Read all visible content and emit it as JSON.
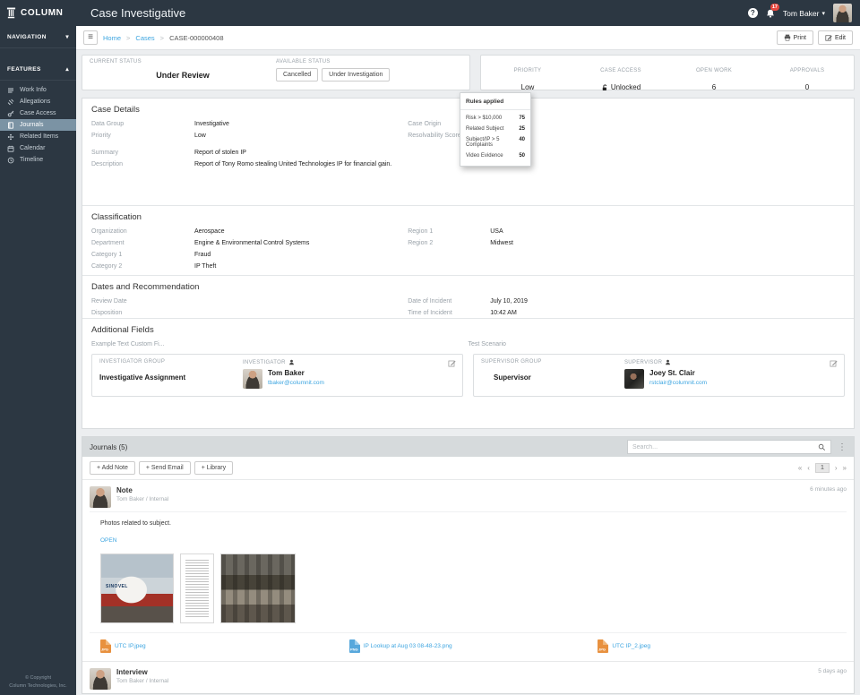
{
  "colors": {
    "topbar": "#2c3742",
    "accent_link": "#3da5e0",
    "selected_nav": "#7b93a4",
    "badge": "#e8483f"
  },
  "glyphs": {
    "plus": "+",
    "caret_down": "▾",
    "caret_up": "▴",
    "kebab": "⋮",
    "crumb_sep": ">",
    "pag_first": "«",
    "pag_prev": "‹",
    "pag_next": "›",
    "pag_last": "»",
    "help": "?",
    "info": "i",
    "hamburger": "≡"
  },
  "topbar": {
    "brand": "COLUMN",
    "title": "Case Investigative",
    "notification_count": "17",
    "user_name": "Tom Baker"
  },
  "sidebar": {
    "navigation_label": "NAVIGATION",
    "features_label": "FEATURES",
    "items": [
      {
        "label": "Work Info"
      },
      {
        "label": "Allegations"
      },
      {
        "label": "Case Access"
      },
      {
        "label": "Journals"
      },
      {
        "label": "Related Items"
      },
      {
        "label": "Calendar"
      },
      {
        "label": "Timeline"
      }
    ],
    "copyright_line1": "© Copyright",
    "copyright_line2": "Column Technologies, Inc."
  },
  "breadcrumb": {
    "home": "Home",
    "cases": "Cases",
    "current": "CASE-000000408"
  },
  "actions": {
    "print": "Print",
    "edit": "Edit"
  },
  "status_panel": {
    "current_status_label": "CURRENT STATUS",
    "current_status": "Under Review",
    "available_status_label": "AVAILABLE STATUS",
    "available_actions": [
      "Cancelled",
      "Under Investigation"
    ],
    "metrics": [
      {
        "label": "PRIORITY",
        "value": "Low"
      },
      {
        "label": "CASE ACCESS",
        "value": "Unlocked"
      },
      {
        "label": "OPEN WORK",
        "value": "6"
      },
      {
        "label": "APPROVALS",
        "value": "0"
      }
    ]
  },
  "rules_popup": {
    "title": "Rules applied",
    "rules": [
      {
        "label": "Risk > $10,000",
        "value": "75"
      },
      {
        "label": "Related Subject",
        "value": "25"
      },
      {
        "label": "Subject/IP > 5 Complaints",
        "value": "40"
      },
      {
        "label": "Video Evidence",
        "value": "50"
      }
    ]
  },
  "case_details": {
    "title": "Case Details",
    "left": [
      {
        "label": "Data Group",
        "value": "Investigative"
      },
      {
        "label": "Priority",
        "value": "Low"
      },
      {
        "label": "Summary",
        "value": "Report of stolen IP"
      },
      {
        "label": "Description",
        "value": "Report of Tony Romo stealing United Technologies IP for financial gain."
      }
    ],
    "right": [
      {
        "label": "Case Origin",
        "value": ""
      },
      {
        "label": "Resolvability Score",
        "value": ""
      }
    ]
  },
  "classification": {
    "title": "Classification",
    "left": [
      {
        "label": "Organization",
        "value": "Aerospace"
      },
      {
        "label": "Department",
        "value": "Engine & Environmental Control Systems"
      },
      {
        "label": "Category 1",
        "value": "Fraud"
      },
      {
        "label": "Category 2",
        "value": "IP Theft"
      }
    ],
    "right": [
      {
        "label": "Region 1",
        "value": "USA"
      },
      {
        "label": "Region 2",
        "value": "Midwest"
      }
    ]
  },
  "dates": {
    "title": "Dates and Recommendation",
    "left": [
      {
        "label": "Review Date",
        "value": ""
      },
      {
        "label": "Disposition",
        "value": ""
      }
    ],
    "right": [
      {
        "label": "Date of Incident",
        "value": "July 10, 2019"
      },
      {
        "label": "Time of Incident",
        "value": "10:42 AM"
      }
    ]
  },
  "additional": {
    "title": "Additional Fields",
    "custom_left": "Example Text Custom Fi...",
    "custom_right": "Test Scenario",
    "investigator_card": {
      "group_label": "INVESTIGATOR GROUP",
      "group_value": "Investigative Assignment",
      "person_label": "INVESTIGATOR",
      "person_name": "Tom Baker",
      "person_email": "tbaker@columnit.com"
    },
    "supervisor_card": {
      "group_label": "SUPERVISOR GROUP",
      "group_value": "Supervisor",
      "person_label": "SUPERVISOR",
      "person_name": "Joey St. Clair",
      "person_email": "rstclair@columnit.com"
    }
  },
  "journals": {
    "title": "Journals (5)",
    "search_placeholder": "Search...",
    "buttons": [
      "Add Note",
      "Send Email",
      "Library"
    ],
    "pagination_page": "1",
    "entries": [
      {
        "type": "Note",
        "author": "Tom Baker / Internal",
        "time": "6 minutes ago",
        "body": "Photos related to subject.",
        "open_label": "OPEN",
        "photo_label": "SINOVEL",
        "attachments": [
          {
            "name": "UTC IP.jpeg",
            "ext": "JPG"
          },
          {
            "name": "IP Lookup at Aug 03 08-48-23.png",
            "ext": "PNG"
          },
          {
            "name": "UTC IP_2.jpeg",
            "ext": "JPG"
          }
        ]
      },
      {
        "type": "Interview",
        "author": "Tom Baker / Internal",
        "time": "5 days ago"
      }
    ]
  }
}
